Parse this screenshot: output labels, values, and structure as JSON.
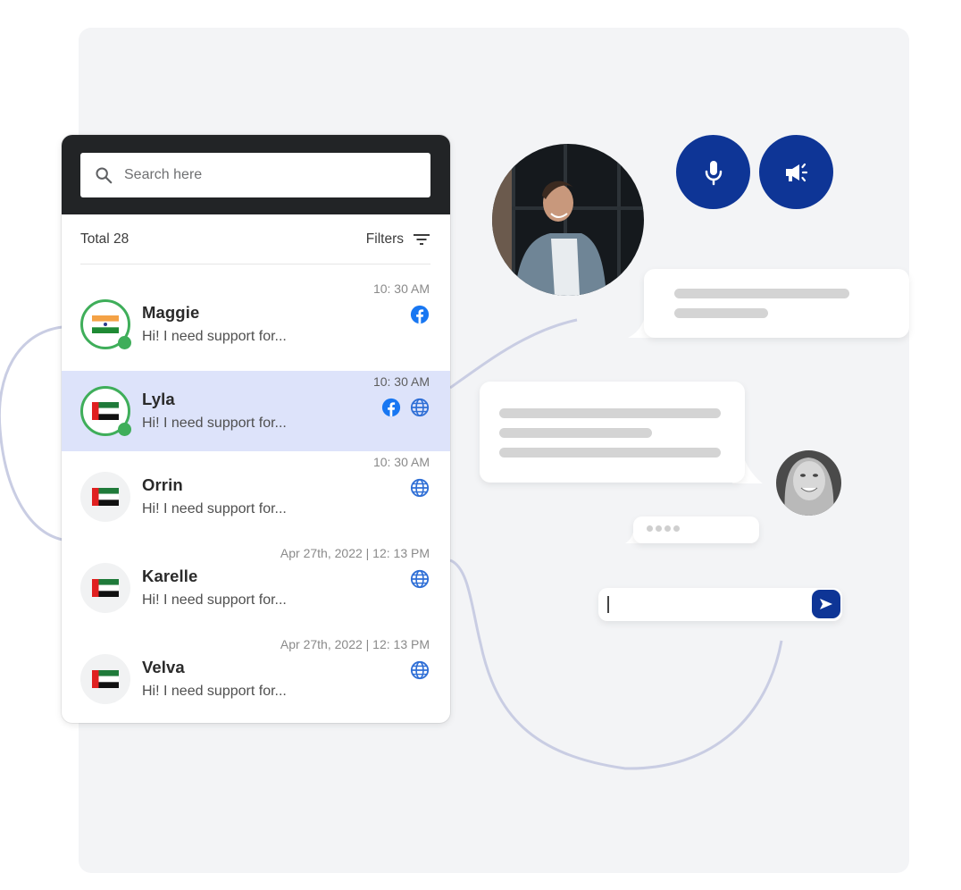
{
  "search": {
    "placeholder": "Search here",
    "icon": "search-icon"
  },
  "summary": {
    "total_label": "Total 28",
    "filters_label": "Filters",
    "filters_icon": "filter-icon"
  },
  "contacts": [
    {
      "name": "Maggie",
      "message": "Hi! I need support for...",
      "time": "10: 30 AM",
      "flag": "india",
      "online": true,
      "selected": false,
      "channels": [
        "facebook"
      ]
    },
    {
      "name": "Lyla",
      "message": "Hi! I need support for...",
      "time": "10: 30 AM",
      "flag": "uae",
      "online": true,
      "selected": true,
      "channels": [
        "facebook",
        "web"
      ]
    },
    {
      "name": "Orrin",
      "message": "Hi! I need support for...",
      "time": "10: 30 AM",
      "flag": "uae",
      "online": false,
      "selected": false,
      "channels": [
        "web"
      ]
    },
    {
      "name": "Karelle",
      "message": "Hi! I need support for...",
      "time": "Apr 27th, 2022 | 12: 13 PM",
      "flag": "uae",
      "online": false,
      "selected": false,
      "channels": [
        "web"
      ]
    },
    {
      "name": "Velva",
      "message": "Hi! I need support for...",
      "time": "Apr 27th, 2022 | 12: 13 PM",
      "flag": "uae",
      "online": false,
      "selected": false,
      "channels": [
        "web"
      ]
    }
  ],
  "chat": {
    "actions": [
      {
        "name": "microphone",
        "icon": "microphone-icon"
      },
      {
        "name": "announcement",
        "icon": "megaphone-icon"
      }
    ],
    "compose": {
      "value": "",
      "send_icon": "send-icon"
    }
  },
  "colors": {
    "accent": "#0e3596",
    "online": "#3fae5a",
    "selected_row": "#dde3fa",
    "header_dark": "#222426",
    "facebook": "#1877f2",
    "web": "#2f6fd6",
    "connector": "#c9cde3"
  }
}
